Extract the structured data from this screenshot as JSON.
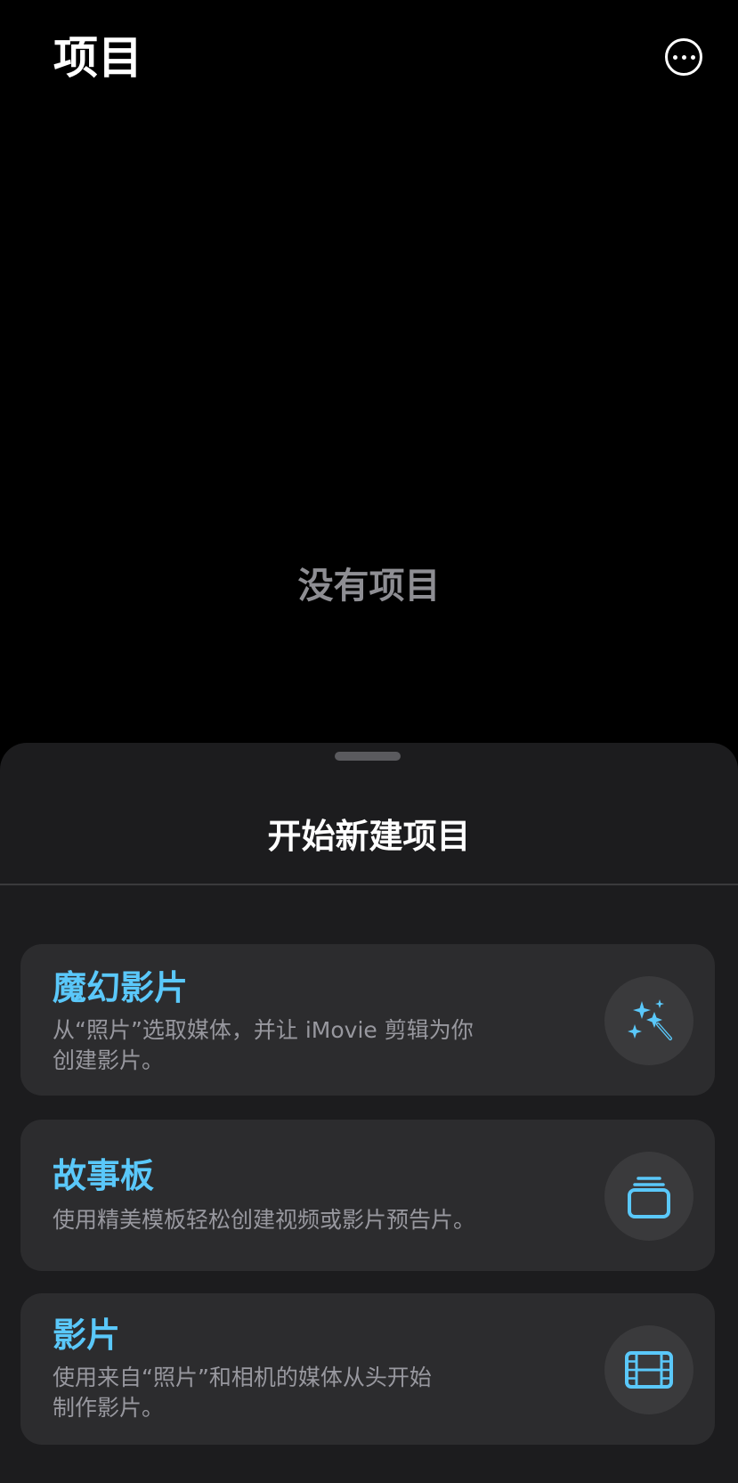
{
  "header": {
    "title": "项目",
    "more_icon": "ellipsis-circle-icon"
  },
  "empty_state": {
    "text": "没有项目"
  },
  "sheet": {
    "title": "开始新建项目",
    "accent_color": "#5ac8fa",
    "cards": [
      {
        "title": "魔幻影片",
        "description_line1": "从“照片”选取媒体，并让 iMovie 剪辑为你",
        "description_line2": "创建影片。",
        "icon": "magic-wand-icon"
      },
      {
        "title": "故事板",
        "description_line1": "使用精美模板轻松创建视频或影片预告片。",
        "description_line2": "",
        "icon": "storyboard-stack-icon"
      },
      {
        "title": "影片",
        "description_line1": "使用来自“照片”和相机的媒体从头开始",
        "description_line2": "制作影片。",
        "icon": "film-strip-icon"
      }
    ]
  }
}
